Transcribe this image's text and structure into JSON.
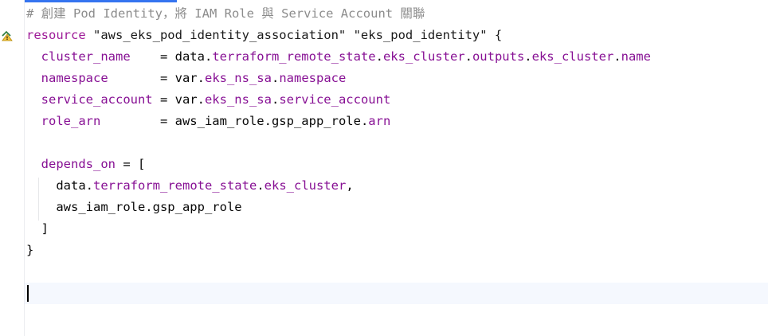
{
  "editor": {
    "lines": [
      {
        "tokens": [
          {
            "t": "# 創建 Pod Identity，將 IAM Role 與 Service Account 關聯",
            "c": "c-comment"
          }
        ]
      },
      {
        "tokens": [
          {
            "t": "resource",
            "c": "c-kw"
          },
          {
            "t": " \"aws_eks_pod_identity_association\" \"eks_pod_identity\" {",
            "c": "c-str2"
          }
        ]
      },
      {
        "tokens": [
          {
            "t": "  cluster_name",
            "c": "c-prop"
          },
          {
            "t": "    = data.",
            "c": "c-plain"
          },
          {
            "t": "terraform_remote_state",
            "c": "c-attr"
          },
          {
            "t": ".",
            "c": "c-plain"
          },
          {
            "t": "eks_cluster",
            "c": "c-attr"
          },
          {
            "t": ".",
            "c": "c-plain"
          },
          {
            "t": "outputs",
            "c": "c-attr"
          },
          {
            "t": ".",
            "c": "c-plain"
          },
          {
            "t": "eks_cluster",
            "c": "c-attr"
          },
          {
            "t": ".",
            "c": "c-plain"
          },
          {
            "t": "name",
            "c": "c-attr"
          }
        ]
      },
      {
        "tokens": [
          {
            "t": "  namespace",
            "c": "c-prop"
          },
          {
            "t": "       = var.",
            "c": "c-plain"
          },
          {
            "t": "eks_ns_sa",
            "c": "c-attr"
          },
          {
            "t": ".",
            "c": "c-plain"
          },
          {
            "t": "namespace",
            "c": "c-attr"
          }
        ]
      },
      {
        "tokens": [
          {
            "t": "  service_account",
            "c": "c-prop"
          },
          {
            "t": " = var.",
            "c": "c-plain"
          },
          {
            "t": "eks_ns_sa",
            "c": "c-attr"
          },
          {
            "t": ".",
            "c": "c-plain"
          },
          {
            "t": "service_account",
            "c": "c-attr"
          }
        ]
      },
      {
        "tokens": [
          {
            "t": "  role_arn",
            "c": "c-prop"
          },
          {
            "t": "        = aws_iam_role.gsp_app_role.",
            "c": "c-plain"
          },
          {
            "t": "arn",
            "c": "c-attr"
          }
        ]
      },
      {
        "tokens": []
      },
      {
        "tokens": [
          {
            "t": "  depends_on",
            "c": "c-prop"
          },
          {
            "t": " = [",
            "c": "c-plain"
          }
        ]
      },
      {
        "tokens": [
          {
            "t": "    data.",
            "c": "c-plain"
          },
          {
            "t": "terraform_remote_state",
            "c": "c-attr"
          },
          {
            "t": ".",
            "c": "c-plain"
          },
          {
            "t": "eks_cluster",
            "c": "c-attr"
          },
          {
            "t": ",",
            "c": "c-plain"
          }
        ]
      },
      {
        "tokens": [
          {
            "t": "    aws_iam_role.gsp_app_role",
            "c": "c-plain"
          }
        ]
      },
      {
        "tokens": [
          {
            "t": "  ]",
            "c": "c-plain"
          }
        ]
      },
      {
        "tokens": [
          {
            "t": "}",
            "c": "c-plain"
          }
        ]
      },
      {
        "tokens": []
      },
      {
        "tokens": [],
        "current": true
      }
    ]
  },
  "gutter": {
    "icon": "warning-icon"
  },
  "colors": {
    "accent": "#3574f0",
    "current_line": "#f5f8fe"
  },
  "progress": {
    "fraction": 0.23
  }
}
